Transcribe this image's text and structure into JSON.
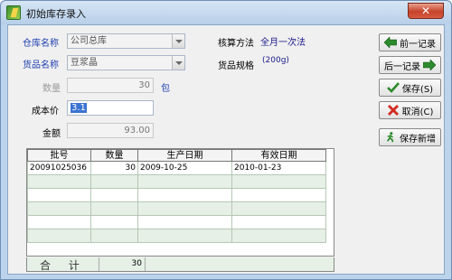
{
  "window": {
    "title": "初始库存录入",
    "close_label": "✕"
  },
  "form": {
    "warehouse_label": "仓库名称",
    "warehouse_value": "公司总库",
    "goods_label": "货品名称",
    "goods_value": "豆浆晶",
    "qty_label": "数量",
    "qty_value": "30",
    "qty_unit": "包",
    "cost_label": "成本价",
    "cost_value": "3.1",
    "amount_label": "金额",
    "amount_value": "93.00",
    "method_label": "核算方法",
    "method_value": "全月一次法",
    "spec_label": "货品规格",
    "spec_value": "(200g)"
  },
  "buttons": {
    "prev": "前一记录",
    "next": "后一记录",
    "save": "保存(S)",
    "cancel": "取消(C)",
    "save_new": "保存新增"
  },
  "grid": {
    "headers": [
      "批号",
      "数量",
      "生产日期",
      "有效日期"
    ],
    "rows": [
      [
        "20091025036",
        "30",
        "2009-10-25",
        "2010-01-23"
      ],
      [
        "",
        "",
        "",
        ""
      ],
      [
        "",
        "",
        "",
        ""
      ],
      [
        "",
        "",
        "",
        ""
      ],
      [
        "",
        "",
        "",
        ""
      ],
      [
        "",
        "",
        "",
        ""
      ]
    ],
    "total_label": "合 计",
    "total_qty": "30"
  },
  "colors": {
    "label_blue": "#1f3fb0",
    "arrow_green": "#2d8a2d",
    "cancel_red": "#d12b1f"
  }
}
